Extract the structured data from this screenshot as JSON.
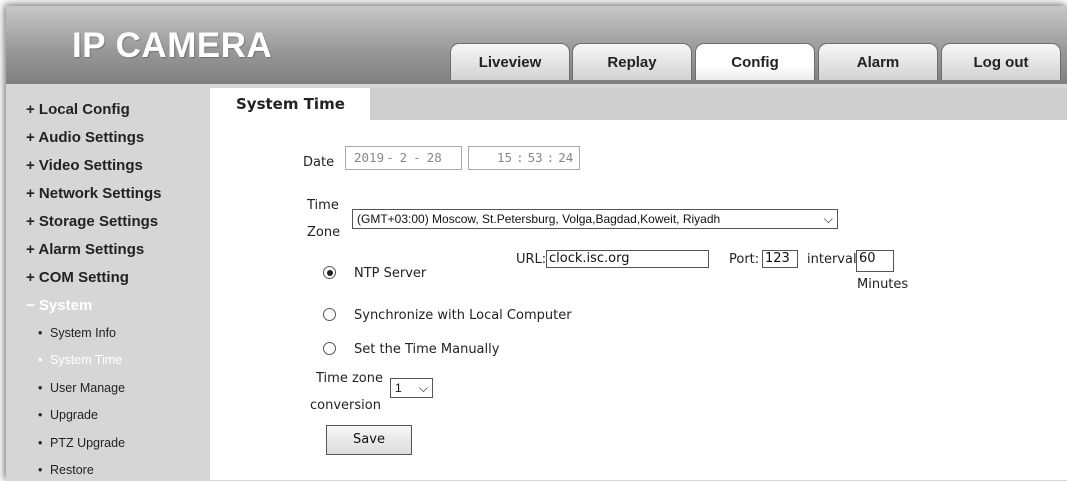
{
  "app": {
    "title": "IP CAMERA"
  },
  "tabs": [
    {
      "label": "Liveview"
    },
    {
      "label": "Replay"
    },
    {
      "label": "Config",
      "active": true
    },
    {
      "label": "Alarm"
    },
    {
      "label": "Log out"
    }
  ],
  "sidebar": {
    "groups": [
      {
        "label": "+ Local Config"
      },
      {
        "label": "+ Audio Settings"
      },
      {
        "label": "+ Video Settings"
      },
      {
        "label": "+ Network Settings"
      },
      {
        "label": "+ Storage Settings"
      },
      {
        "label": "+ Alarm Settings"
      },
      {
        "label": "+ COM Setting"
      },
      {
        "label": "− System",
        "expanded": true
      }
    ],
    "system_items": [
      {
        "label": "System Info"
      },
      {
        "label": "System Time",
        "active": true
      },
      {
        "label": "User Manage"
      },
      {
        "label": "Upgrade"
      },
      {
        "label": "PTZ Upgrade"
      },
      {
        "label": "Restore"
      }
    ],
    "bullet": "•"
  },
  "page": {
    "title": "System Time",
    "date_label": "Date",
    "date": {
      "year": "2019",
      "month": "2",
      "day": "28",
      "sep": "-"
    },
    "time": {
      "hour": "15",
      "minute": "53",
      "second": "24",
      "sep": ":"
    },
    "timezone_label_1": "Time",
    "timezone_label_2": "Zone",
    "timezone_value": "(GMT+03:00) Moscow, St.Petersburg, Volga,Bagdad,Koweit, Riyadh",
    "ntp_label": "NTP Server",
    "url_label": "URL:",
    "url_value": "clock.isc.org",
    "port_label": "Port:",
    "port_value": "123",
    "interval_label": "interval",
    "interval_value": "60",
    "minutes_label": "Minutes",
    "sync_label": "Synchronize with Local Computer",
    "manual_label": "Set the Time Manually",
    "selected_mode": "ntp",
    "tz_conv_label_1": "Time zone",
    "tz_conv_label_2": "conversion",
    "tz_conv_value": "1",
    "save_label": "Save"
  },
  "colors": {
    "header_top": "#c8c8c8",
    "header_bottom": "#7f7f7f",
    "sidebar_bg": "#d6d6d6",
    "active_text": "#ffffff"
  }
}
